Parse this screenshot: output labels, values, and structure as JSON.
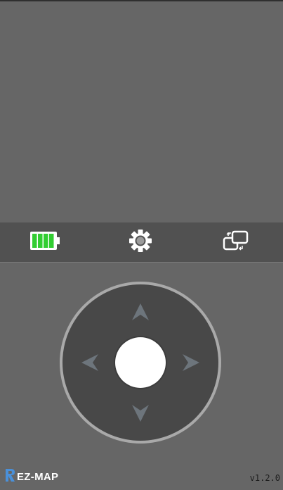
{
  "toolbar": {
    "battery": {
      "icon": "battery-icon",
      "level": 1.0,
      "color": "#32cd32"
    },
    "settings": {
      "icon": "gear-icon"
    },
    "swap": {
      "icon": "swap-windows-icon"
    }
  },
  "joystick": {
    "up_icon": "chevron-up-icon",
    "down_icon": "chevron-down-icon",
    "left_icon": "chevron-left-icon",
    "right_icon": "chevron-right-icon",
    "knob_color": "#ffffff",
    "pad_color": "#484848",
    "ring_color": "#a9a9a9"
  },
  "footer": {
    "logo_letter": "R",
    "logo_text": "EZ-MAP",
    "version": "v1.2.0"
  }
}
